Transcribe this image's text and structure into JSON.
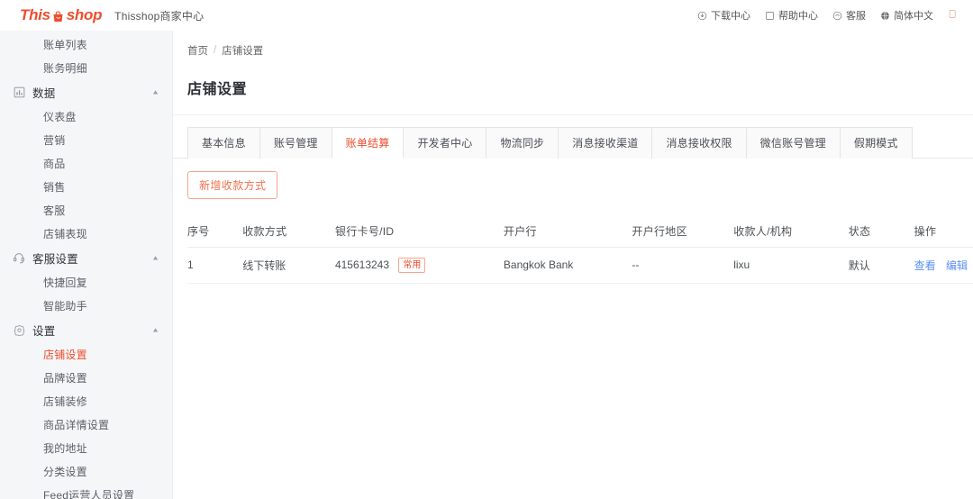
{
  "topbar": {
    "logo_this": "This",
    "logo_shop": "shop",
    "brand_sub": "Thisshop商家中心",
    "items": [
      {
        "label": "下载中心",
        "icon": "download-icon"
      },
      {
        "label": "帮助中心",
        "icon": "help-icon"
      },
      {
        "label": "客服",
        "icon": "service-icon"
      },
      {
        "label": "简体中文",
        "icon": "globe-icon"
      }
    ]
  },
  "sidebar": {
    "items": [
      {
        "label": "账单列表",
        "type": "child",
        "active": false
      },
      {
        "label": "账务明细",
        "type": "child",
        "active": false
      },
      {
        "label": "数据",
        "type": "group",
        "icon": "chart-icon",
        "expanded": true
      },
      {
        "label": "仪表盘",
        "type": "child",
        "active": false
      },
      {
        "label": "营销",
        "type": "child",
        "active": false
      },
      {
        "label": "商品",
        "type": "child",
        "active": false
      },
      {
        "label": "销售",
        "type": "child",
        "active": false
      },
      {
        "label": "客服",
        "type": "child",
        "active": false
      },
      {
        "label": "店铺表现",
        "type": "child",
        "active": false
      },
      {
        "label": "客服设置",
        "type": "group",
        "icon": "headset-icon",
        "expanded": true
      },
      {
        "label": "快捷回复",
        "type": "child",
        "active": false
      },
      {
        "label": "智能助手",
        "type": "child",
        "active": false
      },
      {
        "label": "设置",
        "type": "group",
        "icon": "gear-icon",
        "expanded": true
      },
      {
        "label": "店铺设置",
        "type": "child",
        "active": true
      },
      {
        "label": "品牌设置",
        "type": "child",
        "active": false
      },
      {
        "label": "店铺装修",
        "type": "child",
        "active": false
      },
      {
        "label": "商品详情设置",
        "type": "child",
        "active": false
      },
      {
        "label": "我的地址",
        "type": "child",
        "active": false
      },
      {
        "label": "分类设置",
        "type": "child",
        "active": false
      },
      {
        "label": "Feed运营人员设置",
        "type": "child",
        "active": false
      }
    ],
    "caret_glyph": "▲"
  },
  "breadcrumb": {
    "home": "首页",
    "separator": "/",
    "current": "店铺设置"
  },
  "page_title": "店铺设置",
  "tabs": [
    {
      "label": "基本信息",
      "active": false
    },
    {
      "label": "账号管理",
      "active": false
    },
    {
      "label": "账单结算",
      "active": true
    },
    {
      "label": "开发者中心",
      "active": false
    },
    {
      "label": "物流同步",
      "active": false
    },
    {
      "label": "消息接收渠道",
      "active": false
    },
    {
      "label": "消息接收权限",
      "active": false
    },
    {
      "label": "微信账号管理",
      "active": false
    },
    {
      "label": "假期模式",
      "active": false
    }
  ],
  "toolbar": {
    "add_payment_label": "新增收款方式"
  },
  "table": {
    "headers": [
      "序号",
      "收款方式",
      "银行卡号/ID",
      "开户行",
      "开户行地区",
      "收款人/机构",
      "状态",
      "操作"
    ],
    "rows": [
      {
        "index": "1",
        "method": "线下转账",
        "card": "415613243",
        "card_badge": "常用",
        "bank": "Bangkok Bank",
        "region": "--",
        "payee": "lixu",
        "status": "默认",
        "op_view": "查看",
        "op_edit": "编辑"
      }
    ]
  },
  "colors": {
    "brand": "#ee4d2d",
    "link": "#5b8ff9",
    "sidebar_bg": "#f5f6f8"
  }
}
